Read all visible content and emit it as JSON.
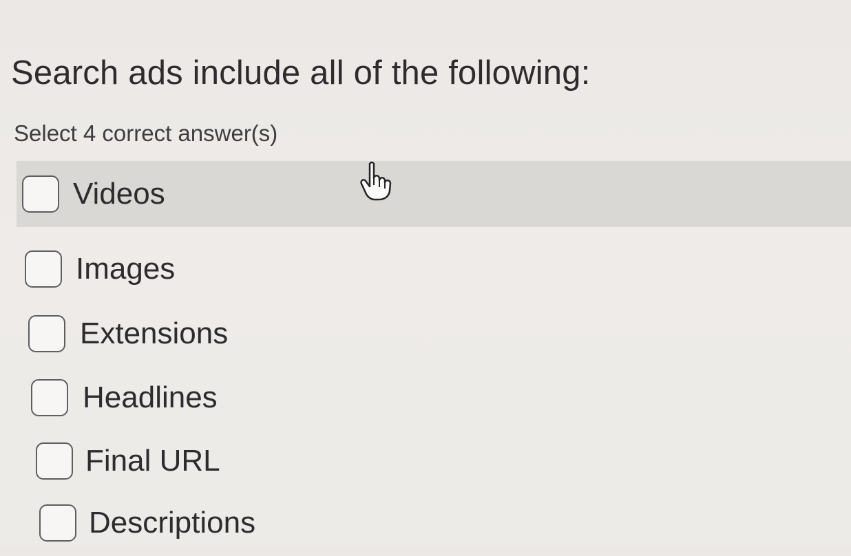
{
  "question": {
    "title": "Search ads include all of the following:",
    "instruction": "Select 4 correct answer(s)"
  },
  "options": [
    {
      "label": "Videos"
    },
    {
      "label": "Images"
    },
    {
      "label": "Extensions"
    },
    {
      "label": "Headlines"
    },
    {
      "label": "Final URL"
    },
    {
      "label": "Descriptions"
    }
  ],
  "cursor": {
    "icon": "hand-pointer-icon"
  }
}
